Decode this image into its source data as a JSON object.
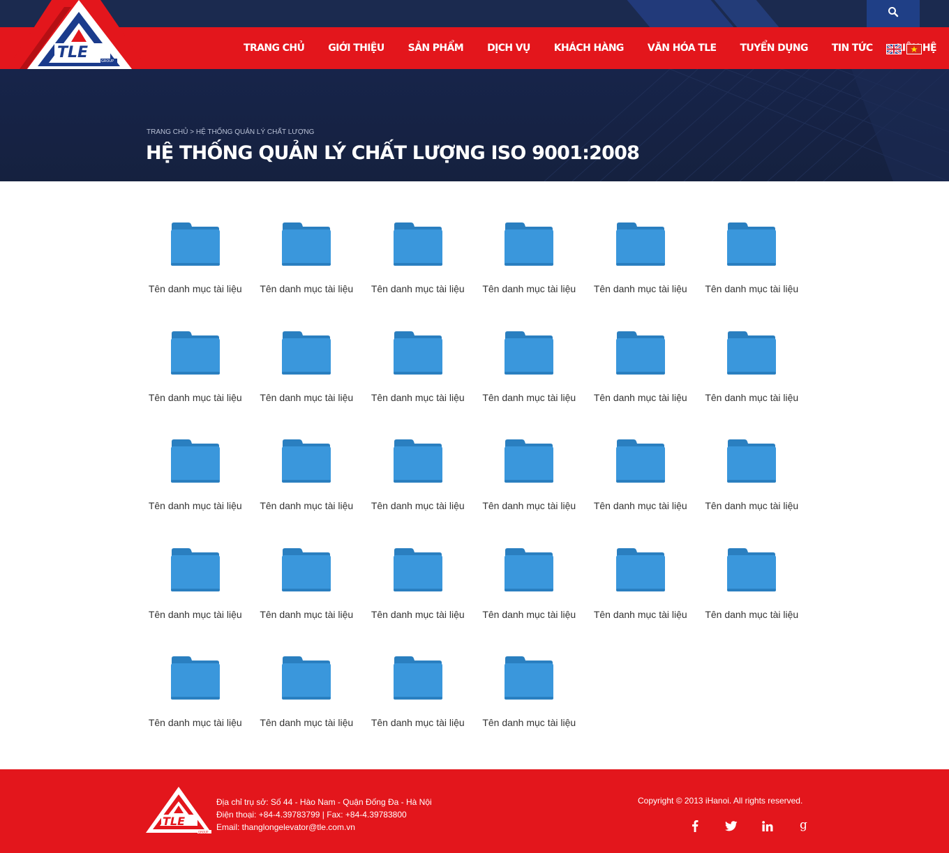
{
  "nav": {
    "items": [
      "TRANG CHỦ",
      "GIỚI THIỆU",
      "SẢN PHẨM",
      "DỊCH VỤ",
      "KHÁCH HÀNG",
      "VĂN HÓA TLE",
      "TUYỂN DỤNG",
      "TIN TỨC",
      "LIÊN HỆ"
    ],
    "languages": [
      "english-flag-icon",
      "vietnam-flag-icon"
    ],
    "search_icon": "search-icon"
  },
  "brand": {
    "logo_text": "TLE",
    "logo_subtext": "GROUP",
    "colors": {
      "red": "#e3161c",
      "navy": "#1b2a4f",
      "folder_blue": "#3a97dc",
      "folder_tab": "#2a7fc0"
    }
  },
  "banner": {
    "breadcrumb_home": "TRANG CHỦ",
    "breadcrumb_separator": ">",
    "breadcrumb_current": "HỆ THỐNG QUẢN LÝ CHẤT LƯỢNG",
    "title": "HỆ THỐNG QUẢN LÝ CHẤT LƯỢNG ISO 9001:2008"
  },
  "folders": {
    "icon": "folder-icon",
    "items": [
      "Tên danh mục tài liệu",
      "Tên danh mục tài liệu",
      "Tên danh mục tài liệu",
      "Tên danh mục tài liệu",
      "Tên danh mục tài liệu",
      "Tên danh mục tài liệu",
      "Tên danh mục tài liệu",
      "Tên danh mục tài liệu",
      "Tên danh mục tài liệu",
      "Tên danh mục tài liệu",
      "Tên danh mục tài liệu",
      "Tên danh mục tài liệu",
      "Tên danh mục tài liệu",
      "Tên danh mục tài liệu",
      "Tên danh mục tài liệu",
      "Tên danh mục tài liệu",
      "Tên danh mục tài liệu",
      "Tên danh mục tài liệu",
      "Tên danh mục tài liệu",
      "Tên danh mục tài liệu",
      "Tên danh mục tài liệu",
      "Tên danh mục tài liệu",
      "Tên danh mục tài liệu",
      "Tên danh mục tài liệu",
      "Tên danh mục tài liệu",
      "Tên danh mục tài liệu",
      "Tên danh mục tài liệu",
      "Tên danh mục tài liệu"
    ]
  },
  "footer": {
    "address": "Địa chỉ trụ sở: Số 44 - Hào Nam - Quận Đống Đa - Hà Nội",
    "phone": "Điện thoại:  +84-4.39783799  |  Fax: +84-4.39783800",
    "email": "Email: thanglongelevator@tle.com.vn",
    "copyright": "Copyright © 2013 iHanoi. All rights reserved.",
    "social": [
      "facebook-icon",
      "twitter-icon",
      "linkedin-icon",
      "google-plus-icon"
    ]
  }
}
